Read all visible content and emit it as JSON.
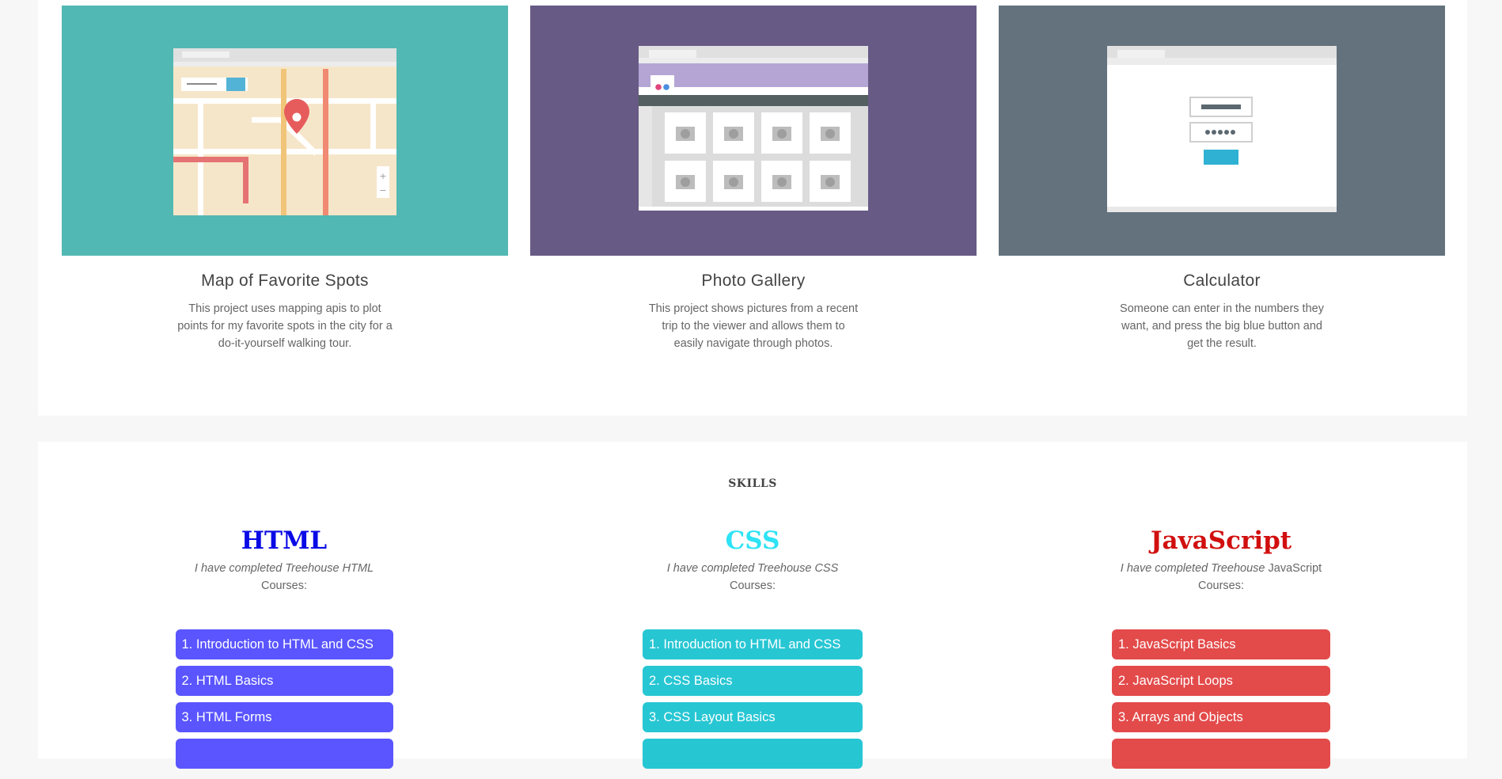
{
  "projects": [
    {
      "title": "Map of Favorite Spots",
      "description": "This project uses mapping apis to plot points for my favorite spots in the city for a do-it-yourself walking tour.",
      "thumbnail_bg": "#52b8b3",
      "thumbnail_icon": "map-illustration"
    },
    {
      "title": "Photo Gallery",
      "description": "This project shows pictures from a recent trip to the viewer and allows them to easily navigate through photos.",
      "thumbnail_bg": "#675a85",
      "thumbnail_icon": "gallery-illustration"
    },
    {
      "title": "Calculator",
      "description": "Someone can enter in the numbers they want, and press the big blue button and get the result.",
      "thumbnail_bg": "#63727d",
      "thumbnail_icon": "login-form-illustration"
    }
  ],
  "skills": {
    "heading": "SKILLS",
    "groups": [
      {
        "title": "HTML",
        "color": "#0a0ae6",
        "desc_italic": "I have completed Treehouse HTML",
        "desc_plain": "Courses:",
        "item_color": "#5a55ff",
        "courses": [
          "1. Introduction to HTML and CSS",
          "2. HTML Basics",
          "3. HTML Forms"
        ]
      },
      {
        "title": "CSS",
        "color": "#2ee3f5",
        "desc_italic": "I have completed Treehouse CSS",
        "desc_plain": "Courses:",
        "item_color": "#27c6d3",
        "courses": [
          "1. Introduction to HTML and CSS",
          "2. CSS Basics",
          "3. CSS Layout Basics"
        ]
      },
      {
        "title": "JavaScript",
        "color": "#d10f0f",
        "desc_italic": "I have completed Treehouse",
        "desc_plain": "JavaScript Courses:",
        "item_color": "#e34a4a",
        "courses": [
          "1. JavaScript Basics",
          "2. JavaScript Loops",
          "3. Arrays and Objects"
        ]
      }
    ]
  }
}
